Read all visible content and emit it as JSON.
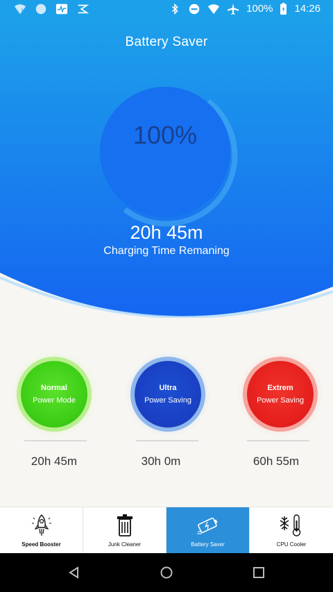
{
  "status_bar": {
    "battery_text": "100%",
    "time": "14:26",
    "icons": [
      "wifi-question-icon",
      "circle-icon",
      "activity-icon",
      "check-icon",
      "bluetooth-icon",
      "do-not-disturb-icon",
      "wifi-icon",
      "airplane-icon",
      "battery-charging-icon"
    ]
  },
  "header": {
    "title": "Battery Saver",
    "percent": "100%",
    "time_remaining": "20h 45m",
    "time_label": "Charging Time Remaning"
  },
  "modes": [
    {
      "line1": "Normal",
      "line2": "Power Mode",
      "value": "20h  45m",
      "color": "#3fcf17"
    },
    {
      "line1": "Ultra",
      "line2": "Power Saving",
      "value": "30h  0m",
      "color": "#1a3ec2"
    },
    {
      "line1": "Extrem",
      "line2": "Power Saving",
      "value": "60h  55m",
      "color": "#e41e1c"
    }
  ],
  "tabs": [
    {
      "label": "Speed Booster",
      "icon": "rocket-icon",
      "active": false
    },
    {
      "label": "Junk Cleaner",
      "icon": "trash-icon",
      "active": false
    },
    {
      "label": "Battery Saver",
      "icon": "battery-icon",
      "active": true
    },
    {
      "label": "CPU Cooler",
      "icon": "thermometer-snowflake-icon",
      "active": false
    }
  ],
  "colors": {
    "hero_gradient_top": "#1da0ea",
    "hero_gradient_bottom": "#1565f0",
    "active_tab": "#2b8fd9"
  }
}
